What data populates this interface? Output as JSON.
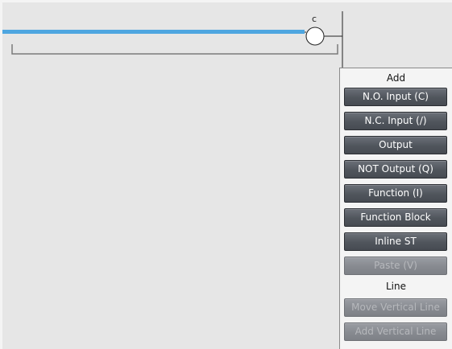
{
  "rung": {
    "coil_variable": "c"
  },
  "menu": {
    "add_label": "Add",
    "add_items": [
      {
        "label": "N.O. Input (C)",
        "enabled": true
      },
      {
        "label": "N.C. Input (/)",
        "enabled": true
      },
      {
        "label": "Output",
        "enabled": true
      },
      {
        "label": "NOT Output (Q)",
        "enabled": true
      },
      {
        "label": "Function (I)",
        "enabled": true
      },
      {
        "label": "Function Block",
        "enabled": true
      },
      {
        "label": "Inline ST",
        "enabled": true
      },
      {
        "label": "Paste (V)",
        "enabled": false
      }
    ],
    "line_label": "Line",
    "line_items": [
      {
        "label": "Move Vertical Line",
        "enabled": false
      },
      {
        "label": "Add Vertical Line",
        "enabled": false
      }
    ]
  },
  "colors": {
    "selected_line": "#4ea6e0",
    "button_enabled": "#55595f",
    "button_disabled": "#878a90"
  }
}
